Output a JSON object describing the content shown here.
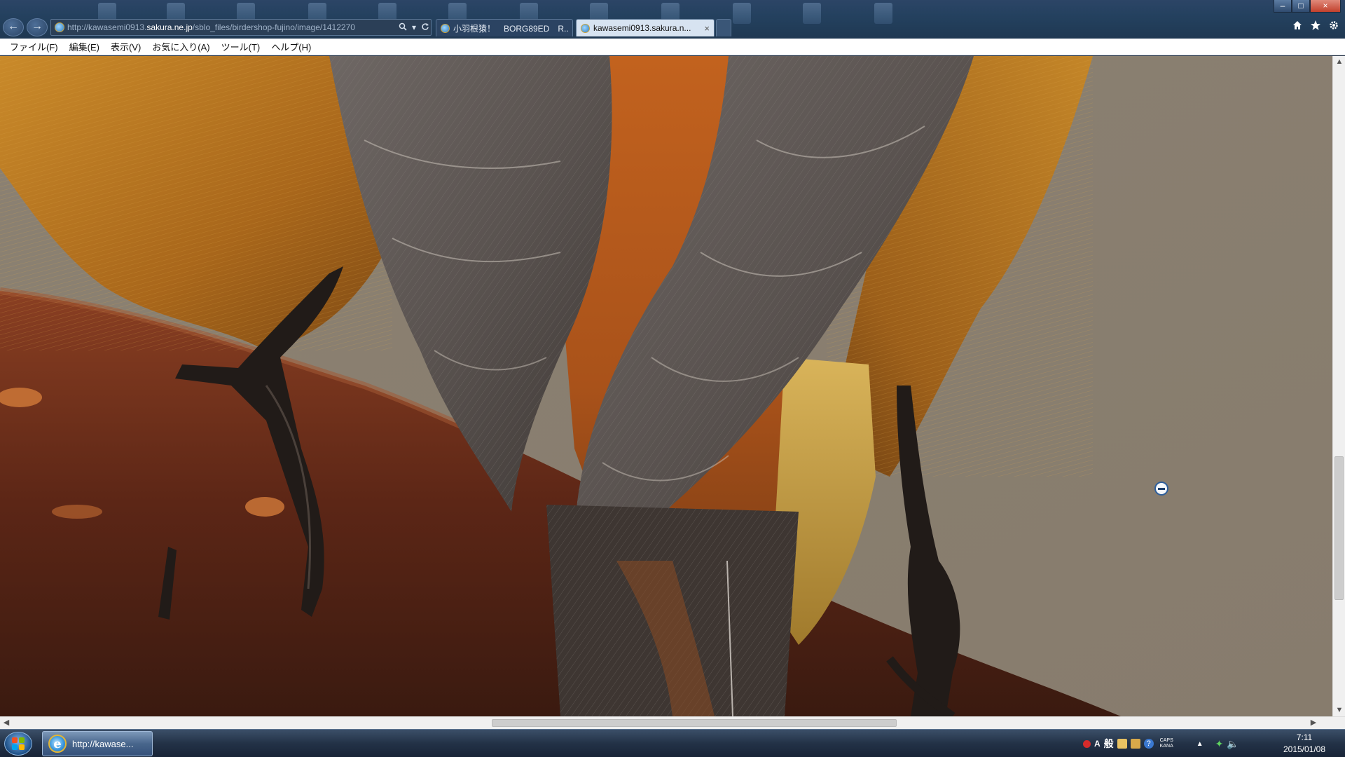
{
  "browser": {
    "address_url_prefix": "http://kawasemi0913.",
    "address_url_domain": "sakura.ne.jp",
    "address_url_suffix": "/sblo_files/birdershop-fujino/image/1412270",
    "address_search_icon": "search-icon",
    "address_refresh_icon": "refresh-icon",
    "tabs": [
      {
        "label": "小羽根猿！　BORG89ED　R...",
        "active": false
      },
      {
        "label": "kawasemi0913.sakura.n...",
        "active": true,
        "close": "×"
      }
    ],
    "nav_back_glyph": "←",
    "nav_forward_glyph": "→",
    "window_controls": {
      "minimize": "–",
      "maximize": "□",
      "close": "×"
    },
    "toolbar_icons": [
      "home-icon",
      "favorites-star-icon",
      "tools-gear-icon"
    ]
  },
  "menu": [
    {
      "label": "ファイル(F)"
    },
    {
      "label": "編集(E)"
    },
    {
      "label": "表示(V)"
    },
    {
      "label": "お気に入り(A)"
    },
    {
      "label": "ツール(T)"
    },
    {
      "label": "ヘルプ(H)"
    }
  ],
  "content": {
    "image_subject": "zoomed bird photograph (tail and legs on branch)",
    "background_color": "#8a7f72"
  },
  "scrollbars": {
    "up": "▲",
    "down": "▼",
    "left": "◀",
    "right": "▶"
  },
  "taskbar": {
    "ie_button_label": "http://kawase...",
    "ie_glyph": "e",
    "tray_ime_mode": "A",
    "tray_ime_text": "般",
    "tray_caps": "CAPS",
    "tray_kana": "KANA",
    "tray_help": "?",
    "time": "7:11",
    "date": "2015/01/08"
  },
  "colors": {
    "titlebar": "#24415f",
    "taskbar": "#233247",
    "menubar": "#ffffff",
    "accent_ie": "#3d9ae0"
  }
}
